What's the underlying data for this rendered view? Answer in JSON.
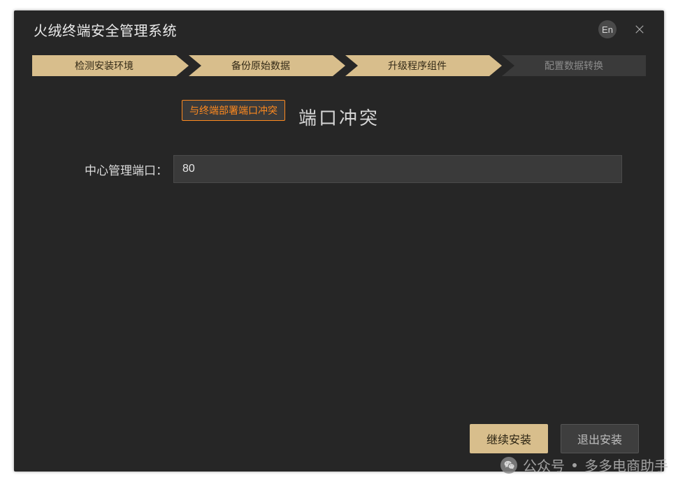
{
  "header": {
    "title": "火绒终端安全管理系统",
    "lang_label": "En"
  },
  "steps": [
    {
      "label": "检测安装环境",
      "active": true
    },
    {
      "label": "备份原始数据",
      "active": true
    },
    {
      "label": "升级程序组件",
      "active": true
    },
    {
      "label": "配置数据转换",
      "active": false
    }
  ],
  "panel": {
    "title": "端口冲突",
    "tooltip": "与终端部署端口冲突",
    "port_label": "中心管理端口：",
    "port_value": "80"
  },
  "buttons": {
    "continue": "继续安装",
    "exit": "退出安装"
  },
  "watermark": {
    "prefix": "公众号",
    "name": "多多电商助手"
  }
}
